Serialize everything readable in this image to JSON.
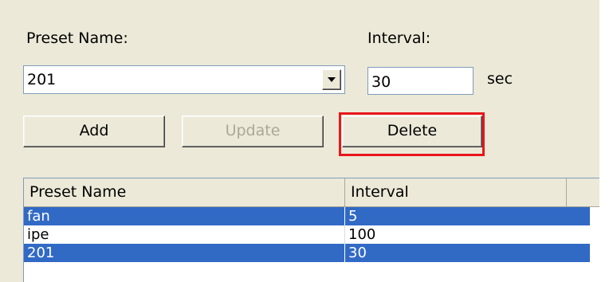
{
  "form": {
    "preset_name_label": "Preset Name:",
    "interval_label": "Interval:",
    "preset_value": "201",
    "interval_value": "30",
    "unit_label": "sec"
  },
  "buttons": {
    "add": "Add",
    "update": "Update",
    "delete": "Delete"
  },
  "table": {
    "columns": [
      "Preset Name",
      "Interval"
    ],
    "rows": [
      {
        "name": "fan",
        "interval": "5",
        "selected": true
      },
      {
        "name": "ipe",
        "interval": "100",
        "selected": false
      },
      {
        "name": "201",
        "interval": "30",
        "selected": true
      }
    ]
  },
  "colors": {
    "selection": "#316ac5",
    "highlight_border": "#e8161b",
    "dialog_bg": "#ece9d8"
  }
}
